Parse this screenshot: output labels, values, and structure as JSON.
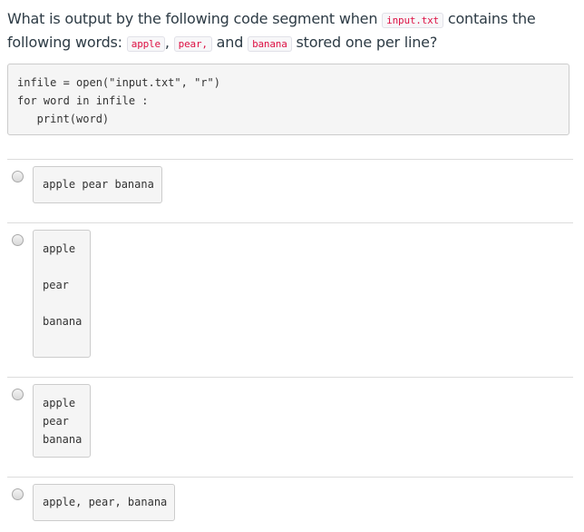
{
  "question": {
    "text_1": "What is output by the following code segment when ",
    "code_file": "input.txt",
    "text_2": " contains the following words: ",
    "code_w1": "apple",
    "text_3": ", ",
    "code_w2": "pear,",
    "text_4": " and ",
    "code_w3": "banana",
    "text_5": " stored one per line?"
  },
  "code": {
    "lines": [
      "infile = open(\"input.txt\", \"r\")",
      "for word in infile :",
      "   print(word)"
    ]
  },
  "options": [
    {
      "lines": [
        "apple pear banana"
      ]
    },
    {
      "lines": [
        "apple",
        "",
        "pear",
        "",
        "banana"
      ]
    },
    {
      "lines": [
        "apple",
        "pear",
        "banana"
      ]
    },
    {
      "lines": [
        "apple, pear, banana"
      ]
    }
  ]
}
